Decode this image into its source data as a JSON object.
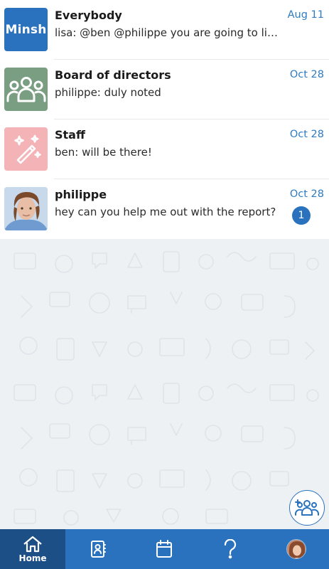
{
  "chats": [
    {
      "name": "Everybody",
      "preview": "lisa: @ben @philippe you are going to like this",
      "date": "Aug 11",
      "avatar_text": "Minsh",
      "avatar_color": "#2a72bd"
    },
    {
      "name": "Board of directors",
      "preview": "philippe: duly noted",
      "date": "Oct 28",
      "avatar_icon": "group-icon",
      "avatar_color": "#7a9e82"
    },
    {
      "name": "Staff",
      "preview": "ben: will be there!",
      "date": "Oct 28",
      "avatar_icon": "magic-wand-icon",
      "avatar_color": "#f4b3b7"
    },
    {
      "name": "philippe",
      "preview": "hey can you help me out with the report?",
      "date": "Oct 28",
      "unread": "1",
      "avatar_icon": "user-photo"
    }
  ],
  "nav": {
    "home_label": "Home",
    "items": [
      "home-icon",
      "contacts-icon",
      "calendar-icon",
      "help-icon",
      "profile-avatar"
    ]
  },
  "colors": {
    "primary": "#2a72bd",
    "nav_active": "#1c4f86",
    "date": "#2f7bc2"
  }
}
